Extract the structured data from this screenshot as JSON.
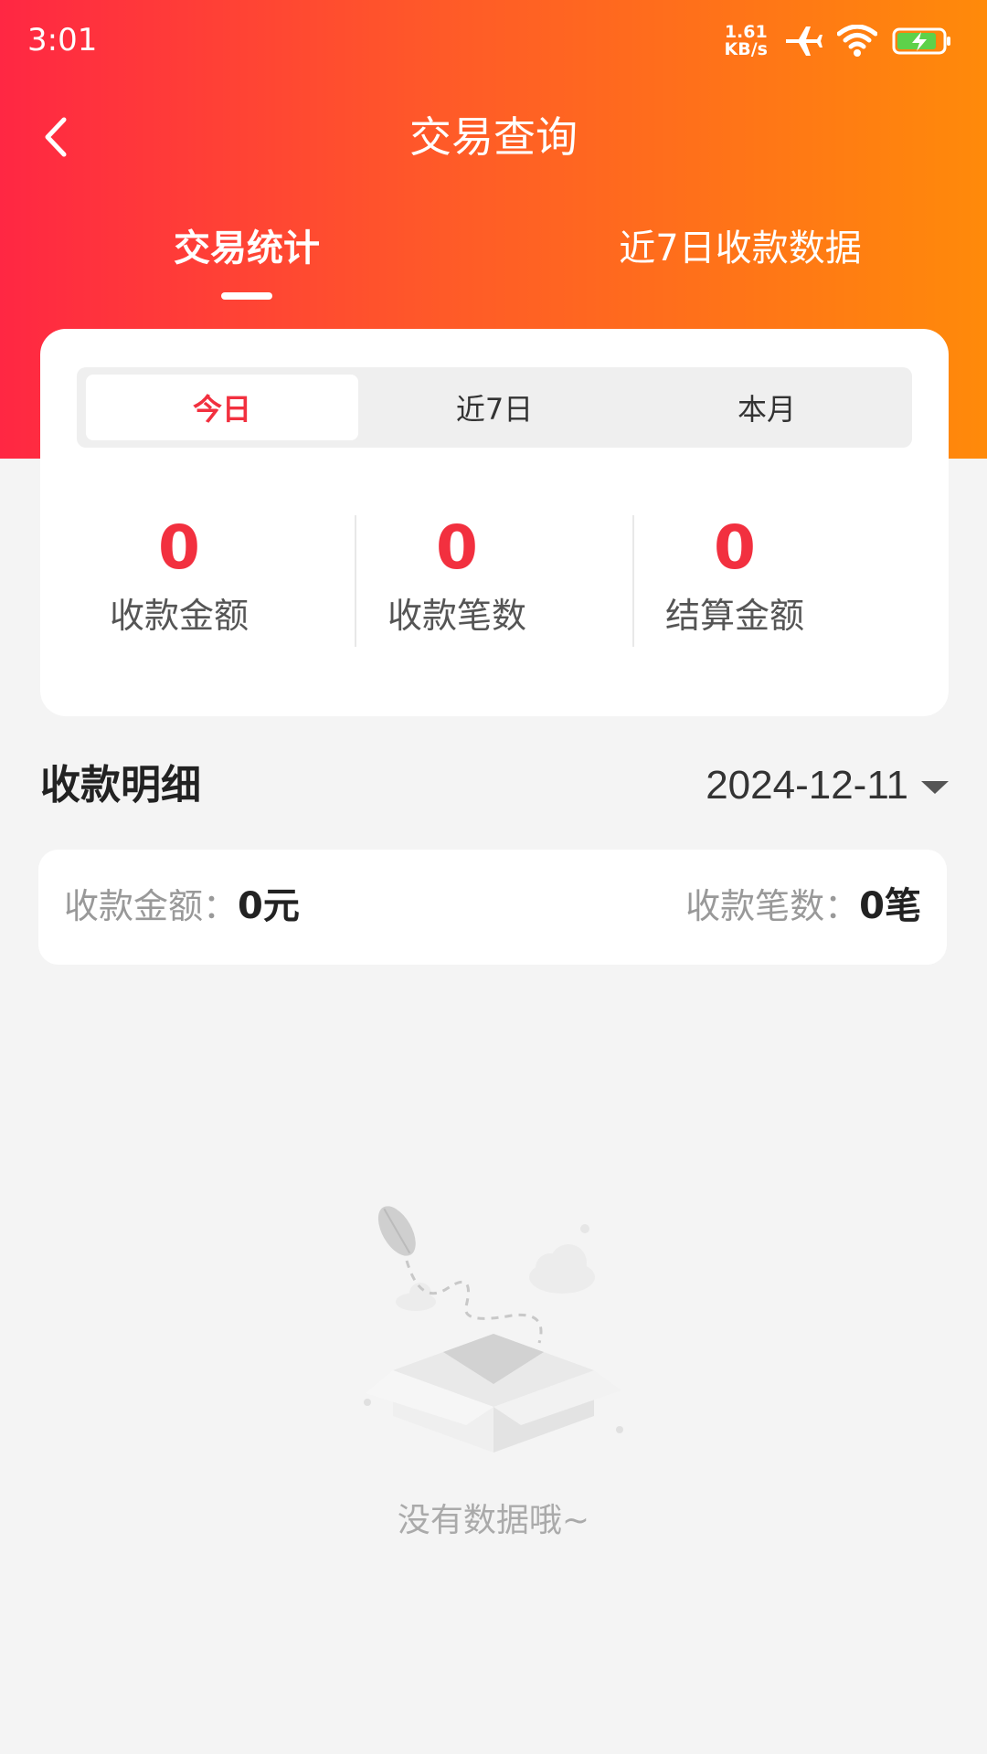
{
  "status_bar": {
    "time": "3:01",
    "net_speed_value": "1.61",
    "net_speed_unit": "KB/s",
    "icons": [
      "airplane-icon",
      "wifi-icon",
      "battery-charging-icon"
    ]
  },
  "nav": {
    "title": "交易查询",
    "back_icon": "chevron-left-icon"
  },
  "tabs": [
    {
      "label": "交易统计",
      "active": true
    },
    {
      "label": "近7日收款数据",
      "active": false
    }
  ],
  "period_options": [
    {
      "label": "今日",
      "selected": true
    },
    {
      "label": "近7日",
      "selected": false
    },
    {
      "label": "本月",
      "selected": false
    }
  ],
  "metrics": [
    {
      "value": "0",
      "label": "收款金额"
    },
    {
      "value": "0",
      "label": "收款笔数"
    },
    {
      "value": "0",
      "label": "结算金额"
    }
  ],
  "detail": {
    "title": "收款明细",
    "date": "2024-12-11"
  },
  "summary": {
    "amount_label": "收款金额：",
    "amount_value": "0元",
    "count_label": "收款笔数：",
    "count_value": "0笔"
  },
  "empty": {
    "text": "没有数据哦~",
    "illustration": "empty-box-illustration"
  },
  "colors": {
    "gradient_start": "#ff2743",
    "gradient_end": "#ff8a0a",
    "accent": "#f2303f",
    "background": "#f4f4f4"
  }
}
